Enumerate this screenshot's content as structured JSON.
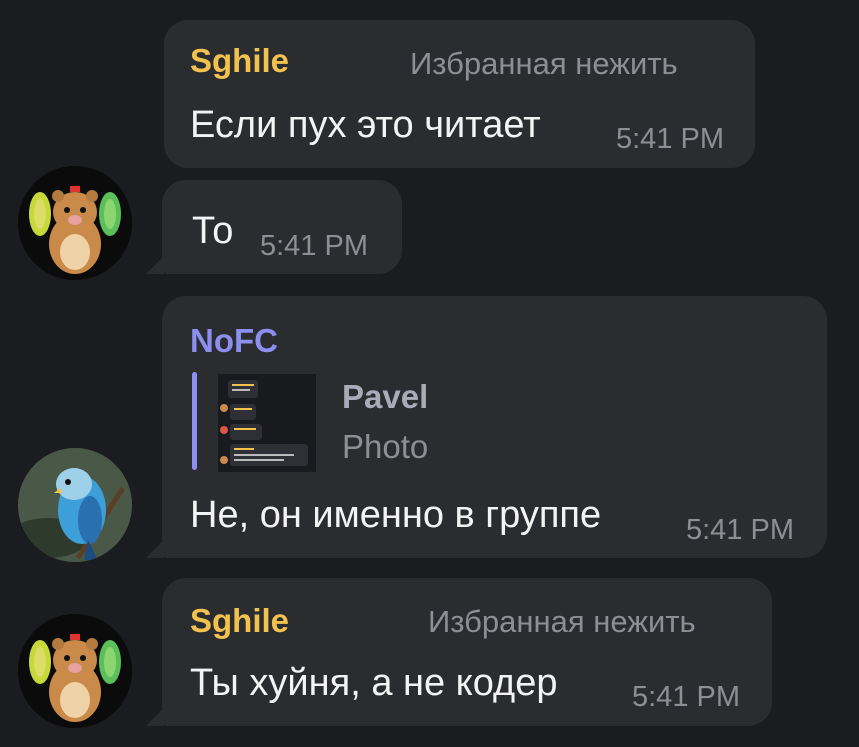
{
  "messages": [
    {
      "author": "Sghile",
      "author_color": "#f2c14e",
      "rank": "Избранная нежить",
      "text": "Если пух это читает",
      "time": "5:41 PM"
    },
    {
      "text": "То",
      "time": "5:41 PM",
      "avatar": "hamster-avatar"
    },
    {
      "author": "NoFC",
      "author_color": "#8c8ff0",
      "reply": {
        "name": "Pavel",
        "text": "Photo"
      },
      "text": "Не, он именно в группе",
      "time": "5:41 PM",
      "avatar": "budgie-avatar"
    },
    {
      "author": "Sghile",
      "author_color": "#f2c14e",
      "rank": "Избранная нежить",
      "text": "Ты хуйня, а не кодер",
      "time": "5:41 PM",
      "avatar": "hamster-avatar"
    }
  ]
}
